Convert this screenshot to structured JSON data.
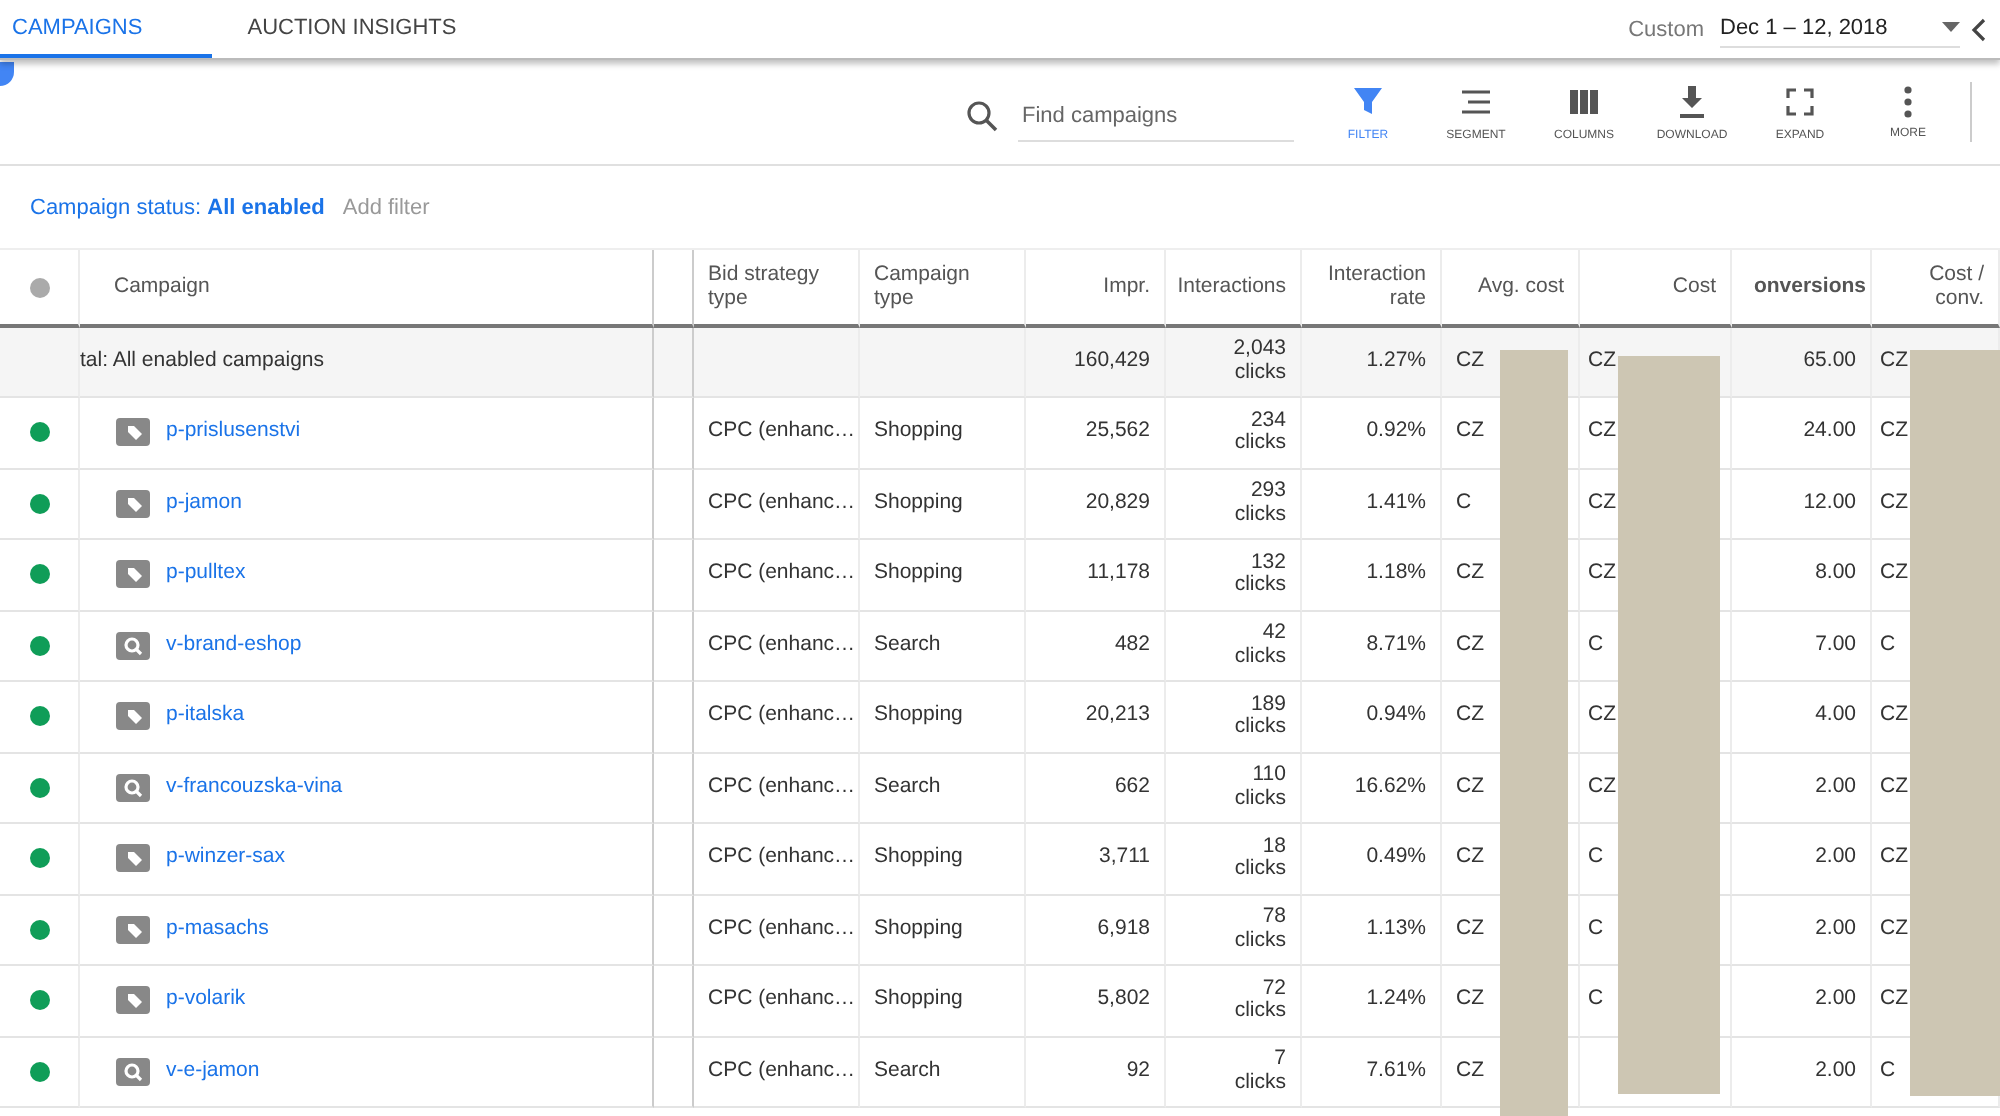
{
  "tabs": [
    {
      "label": "CAMPAIGNS",
      "selected": true
    },
    {
      "label": "AUCTION INSIGHTS",
      "selected": false
    }
  ],
  "date_range": {
    "label": "Custom",
    "value": "Dec 1 – 12, 2018"
  },
  "search": {
    "placeholder": "Find campaigns"
  },
  "tools": [
    {
      "kind": "filter",
      "label": "FILTER",
      "selected": true
    },
    {
      "kind": "segment",
      "label": "SEGMENT",
      "selected": false
    },
    {
      "kind": "columns",
      "label": "COLUMNS",
      "selected": false
    },
    {
      "kind": "download",
      "label": "DOWNLOAD",
      "selected": false
    },
    {
      "kind": "expand",
      "label": "EXPAND",
      "selected": false
    },
    {
      "kind": "more",
      "label": "MORE",
      "selected": false
    }
  ],
  "filter_bar": {
    "prefix": "Campaign status:",
    "value": "All enabled",
    "add": "Add filter"
  },
  "table": {
    "columns": [
      "Campaign",
      "Bid strategy type",
      "Campaign type",
      "Impr.",
      "Interactions",
      "Interaction rate",
      "Avg. cost",
      "Cost",
      "onversions",
      "Cost / conv."
    ],
    "total": {
      "label": "tal: All enabled campaigns",
      "impr": "160,429",
      "interactions": "2,043",
      "unit": "clicks",
      "rate": "1.27%",
      "avg_cost": "CZ",
      "cost": "CZ",
      "conversions": "65.00",
      "cost_conv": "CZ"
    },
    "rows": [
      {
        "color": "#0f9d58",
        "kind": "shopping",
        "name": "p-prislusenstvi",
        "bid": "CPC (enhanc…",
        "type": "Shopping",
        "impr": "25,562",
        "interactions": "234",
        "unit": "clicks",
        "rate": "0.92%",
        "avg_cost": "CZ",
        "cost": "CZ",
        "conversions": "24.00",
        "cost_conv": "CZ"
      },
      {
        "color": "#0f9d58",
        "kind": "shopping",
        "name": "p-jamon",
        "bid": "CPC (enhanc…",
        "type": "Shopping",
        "impr": "20,829",
        "interactions": "293",
        "unit": "clicks",
        "rate": "1.41%",
        "avg_cost": "C",
        "cost": "CZ",
        "conversions": "12.00",
        "cost_conv": "CZ"
      },
      {
        "color": "#0f9d58",
        "kind": "shopping",
        "name": "p-pulltex",
        "bid": "CPC (enhanc…",
        "type": "Shopping",
        "impr": "11,178",
        "interactions": "132",
        "unit": "clicks",
        "rate": "1.18%",
        "avg_cost": "CZ",
        "cost": "CZ",
        "conversions": "8.00",
        "cost_conv": "CZ"
      },
      {
        "color": "#0f9d58",
        "kind": "search",
        "name": "v-brand-eshop",
        "bid": "CPC (enhanc…",
        "type": "Search",
        "impr": "482",
        "interactions": "42",
        "unit": "clicks",
        "rate": "8.71%",
        "avg_cost": "CZ",
        "cost": "C",
        "conversions": "7.00",
        "cost_conv": "C"
      },
      {
        "color": "#0f9d58",
        "kind": "shopping",
        "name": "p-italska",
        "bid": "CPC (enhanc…",
        "type": "Shopping",
        "impr": "20,213",
        "interactions": "189",
        "unit": "clicks",
        "rate": "0.94%",
        "avg_cost": "CZ",
        "cost": "CZ",
        "conversions": "4.00",
        "cost_conv": "CZ"
      },
      {
        "color": "#0f9d58",
        "kind": "search",
        "name": "v-francouzska-vina",
        "bid": "CPC (enhanc…",
        "type": "Search",
        "impr": "662",
        "interactions": "110",
        "unit": "clicks",
        "rate": "16.62%",
        "avg_cost": "CZ",
        "cost": "CZ",
        "conversions": "2.00",
        "cost_conv": "CZ"
      },
      {
        "color": "#0f9d58",
        "kind": "shopping",
        "name": "p-winzer-sax",
        "bid": "CPC (enhanc…",
        "type": "Shopping",
        "impr": "3,711",
        "interactions": "18",
        "unit": "clicks",
        "rate": "0.49%",
        "avg_cost": "CZ",
        "cost": "C",
        "conversions": "2.00",
        "cost_conv": "CZ"
      },
      {
        "color": "#0f9d58",
        "kind": "shopping",
        "name": "p-masachs",
        "bid": "CPC (enhanc…",
        "type": "Shopping",
        "impr": "6,918",
        "interactions": "78",
        "unit": "clicks",
        "rate": "1.13%",
        "avg_cost": "CZ",
        "cost": "C",
        "conversions": "2.00",
        "cost_conv": "CZ"
      },
      {
        "color": "#0f9d58",
        "kind": "shopping",
        "name": "p-volarik",
        "bid": "CPC (enhanc…",
        "type": "Shopping",
        "impr": "5,802",
        "interactions": "72",
        "unit": "clicks",
        "rate": "1.24%",
        "avg_cost": "CZ",
        "cost": "C",
        "conversions": "2.00",
        "cost_conv": "CZ"
      },
      {
        "color": "#0f9d58",
        "kind": "search",
        "name": "v-e-jamon",
        "bid": "CPC (enhanc…",
        "type": "Search",
        "impr": "92",
        "interactions": "7",
        "unit": "clicks",
        "rate": "7.61%",
        "avg_cost": "CZ",
        "conversions": "2.00",
        "cost_conv": "C"
      }
    ]
  }
}
